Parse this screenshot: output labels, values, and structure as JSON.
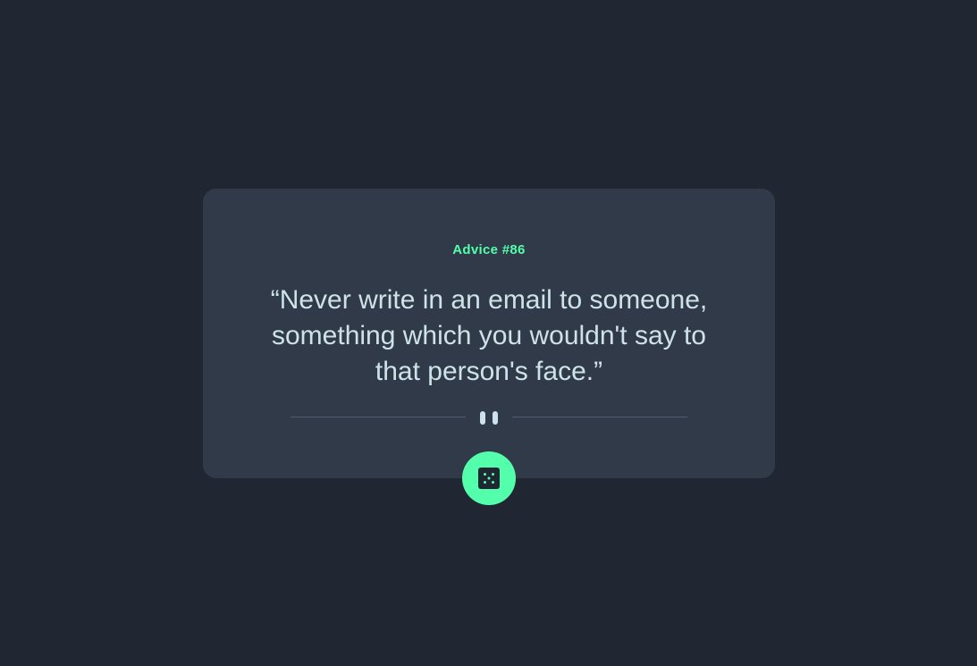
{
  "advice": {
    "label": "Advice #86",
    "quote": "“Never write in an email to someone, something which you wouldn't say to that person's face.”"
  },
  "divider": {
    "icon": "pause-icon"
  },
  "dice_button": {
    "icon": "dice-icon"
  },
  "colors": {
    "background": "#202632",
    "card": "#313a48",
    "accent": "#53ffaa",
    "text": "#cee3e9",
    "divider": "#4f5d74"
  }
}
